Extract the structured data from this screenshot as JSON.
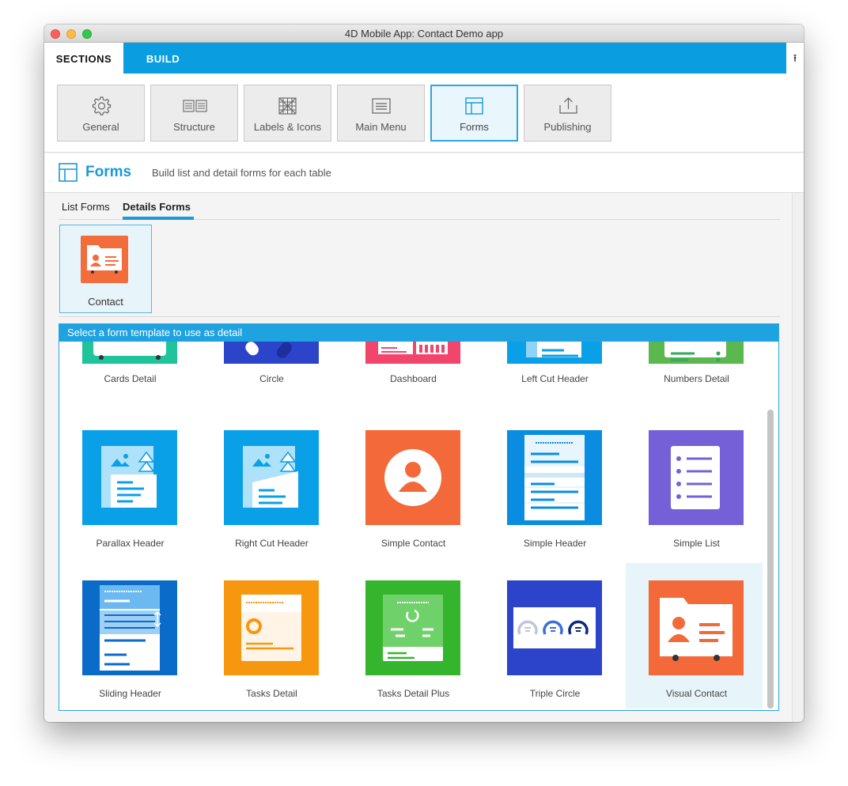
{
  "window": {
    "title": "4D Mobile App: Contact Demo app"
  },
  "topbar": {
    "sections_tab": "SECTIONS",
    "build_tab": "BUILD",
    "upload_icon": "upload-icon"
  },
  "sections": [
    {
      "label": "General",
      "icon": "gear-icon"
    },
    {
      "label": "Structure",
      "icon": "structure-icon"
    },
    {
      "label": "Labels & Icons",
      "icon": "labels-icons-icon"
    },
    {
      "label": "Main Menu",
      "icon": "menu-icon"
    },
    {
      "label": "Forms",
      "icon": "forms-icon",
      "active": true
    },
    {
      "label": "Publishing",
      "icon": "publish-icon"
    }
  ],
  "header": {
    "title": "Forms",
    "description": "Build list and detail forms for each table"
  },
  "subtabs": {
    "list": "List Forms",
    "details": "Details Forms"
  },
  "tables": [
    {
      "label": "Contact"
    }
  ],
  "picker": {
    "heading": "Select a form template to use as detail",
    "templates": [
      {
        "label": "Cards Detail",
        "color": "#1fc49a"
      },
      {
        "label": "Circle",
        "color": "#2c44c9"
      },
      {
        "label": "Dashboard",
        "color": "#f2456b"
      },
      {
        "label": "Left Cut Header",
        "color": "#0aa0e8"
      },
      {
        "label": "Numbers Detail",
        "color": "#5ab84f"
      },
      {
        "label": "Parallax Header",
        "color": "#0aa0e8"
      },
      {
        "label": "Right Cut Header",
        "color": "#0aa0e8"
      },
      {
        "label": "Simple Contact",
        "color": "#f3693a"
      },
      {
        "label": "Simple Header",
        "color": "#0a8de0"
      },
      {
        "label": "Simple List",
        "color": "#7660d8"
      },
      {
        "label": "Sliding Header",
        "color": "#0a6bc8"
      },
      {
        "label": "Tasks Detail",
        "color": "#f7970f"
      },
      {
        "label": "Tasks Detail Plus",
        "color": "#35b52d"
      },
      {
        "label": "Triple Circle",
        "color": "#2c44c9"
      },
      {
        "label": "Visual Contact",
        "color": "#f3693a",
        "selected": true
      }
    ]
  }
}
